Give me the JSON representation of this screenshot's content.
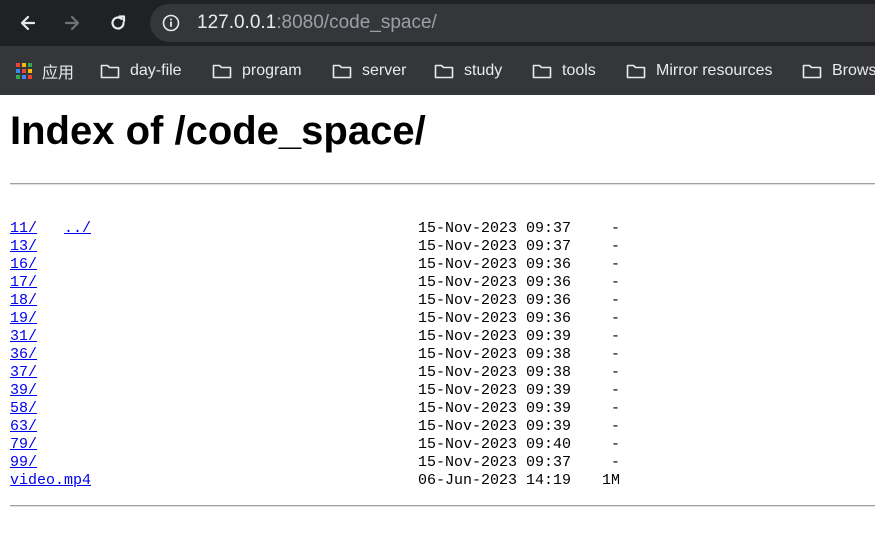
{
  "browser": {
    "url_host": "127.0.0.1",
    "url_rest": ":8080/code_space/",
    "bookmarks": [
      {
        "label": "应用",
        "icon": "apps-grid-icon"
      },
      {
        "label": "day-file",
        "icon": "folder-icon"
      },
      {
        "label": "program",
        "icon": "folder-icon"
      },
      {
        "label": "server",
        "icon": "folder-icon"
      },
      {
        "label": "study",
        "icon": "folder-icon"
      },
      {
        "label": "tools",
        "icon": "folder-icon"
      },
      {
        "label": "Mirror resources",
        "icon": "folder-icon"
      },
      {
        "label": "Brows",
        "icon": "folder-icon"
      }
    ]
  },
  "page": {
    "title": "Index of /code_space/",
    "parent_link": "../",
    "entries": [
      {
        "name": "11/",
        "date": "15-Nov-2023 09:37",
        "size": "-"
      },
      {
        "name": "13/",
        "date": "15-Nov-2023 09:37",
        "size": "-"
      },
      {
        "name": "16/",
        "date": "15-Nov-2023 09:36",
        "size": "-"
      },
      {
        "name": "17/",
        "date": "15-Nov-2023 09:36",
        "size": "-"
      },
      {
        "name": "18/",
        "date": "15-Nov-2023 09:36",
        "size": "-"
      },
      {
        "name": "19/",
        "date": "15-Nov-2023 09:36",
        "size": "-"
      },
      {
        "name": "31/",
        "date": "15-Nov-2023 09:39",
        "size": "-"
      },
      {
        "name": "36/",
        "date": "15-Nov-2023 09:38",
        "size": "-"
      },
      {
        "name": "37/",
        "date": "15-Nov-2023 09:38",
        "size": "-"
      },
      {
        "name": "39/",
        "date": "15-Nov-2023 09:39",
        "size": "-"
      },
      {
        "name": "58/",
        "date": "15-Nov-2023 09:39",
        "size": "-"
      },
      {
        "name": "63/",
        "date": "15-Nov-2023 09:39",
        "size": "-"
      },
      {
        "name": "79/",
        "date": "15-Nov-2023 09:40",
        "size": "-"
      },
      {
        "name": "99/",
        "date": "15-Nov-2023 09:37",
        "size": "-"
      },
      {
        "name": "video.mp4",
        "date": "06-Jun-2023 14:19",
        "size": "1M"
      }
    ]
  }
}
